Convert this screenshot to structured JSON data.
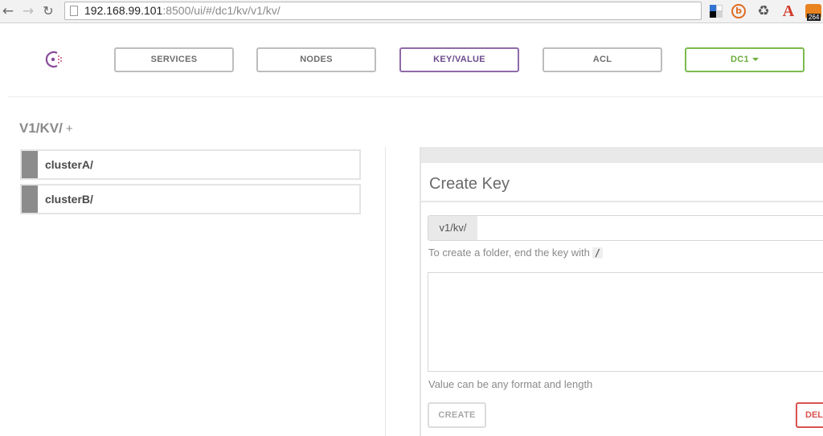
{
  "browser": {
    "url_host": "192.168.99.101",
    "url_rest": ":8500/ui/#/dc1/kv/v1/kv/",
    "rss_badge": "264",
    "icons": [
      "back-arrow-icon",
      "forward-arrow-icon",
      "reload-icon",
      "page-icon",
      "delicious-icon",
      "b-extension-icon",
      "recycle-icon",
      "a-extension-icon",
      "rss-icon"
    ]
  },
  "header": {
    "nav": {
      "services": "SERVICES",
      "nodes": "NODES",
      "kv": "KEY/VALUE",
      "acl": "ACL",
      "dc": "DC1"
    }
  },
  "breadcrumb": {
    "path": "V1/KV/",
    "add": "+"
  },
  "keys": [
    {
      "label": "clusterA/"
    },
    {
      "label": "clusterB/"
    }
  ],
  "create_panel": {
    "title": "Create Key",
    "prefix": "v1/kv/",
    "key_value": "",
    "folder_hint": "To create a folder, end the key with",
    "folder_char": "/",
    "value_hint": "Value can be any format and length",
    "create_label": "CREATE",
    "delete_label": "DEL"
  },
  "colors": {
    "active_nav": "#8f6aa8",
    "dc_nav": "#7cbb4d",
    "delete": "#d9534f"
  }
}
